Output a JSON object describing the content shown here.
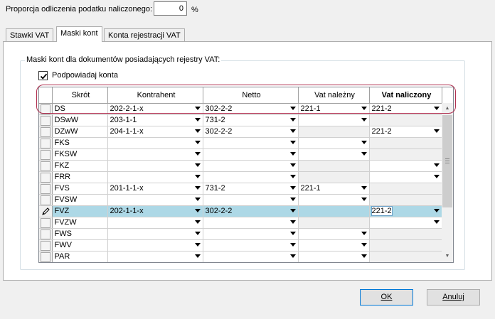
{
  "top": {
    "label": "Proporcja odliczenia podatku naliczonego:",
    "value": "0",
    "unit": "%"
  },
  "tabs": [
    {
      "label": "Stawki VAT",
      "active": false
    },
    {
      "label": "Maski kont",
      "active": true
    },
    {
      "label": "Konta rejestracji VAT",
      "active": false
    }
  ],
  "group": {
    "title": "Maski kont dla dokumentów posiadających rejestry VAT:",
    "checkbox_label": "Podpowiadaj konta",
    "checkbox_checked": true
  },
  "grid": {
    "columns": [
      "Skrót",
      "Kontrahent",
      "Netto",
      "Vat należny",
      "Vat naliczony"
    ],
    "rows": [
      {
        "skrot": "DS",
        "kontrahent": "202-2-1-x",
        "netto": "302-2-2",
        "vat_nalezny": "221-1",
        "vat_naliczony": "221-2"
      },
      {
        "skrot": "DSwW",
        "kontrahent": "203-1-1",
        "netto": "731-2",
        "vat_nalezny": "",
        "vat_naliczony": ""
      },
      {
        "skrot": "DZwW",
        "kontrahent": "204-1-1-x",
        "netto": "302-2-2",
        "vat_nalezny": "",
        "vat_naliczony": "221-2"
      },
      {
        "skrot": "FKS",
        "kontrahent": "",
        "netto": "",
        "vat_nalezny": "",
        "vat_naliczony": ""
      },
      {
        "skrot": "FKSW",
        "kontrahent": "",
        "netto": "",
        "vat_nalezny": "",
        "vat_naliczony": ""
      },
      {
        "skrot": "FKZ",
        "kontrahent": "",
        "netto": "",
        "vat_nalezny": "",
        "vat_naliczony": ""
      },
      {
        "skrot": "FRR",
        "kontrahent": "",
        "netto": "",
        "vat_nalezny": "",
        "vat_naliczony": ""
      },
      {
        "skrot": "FVS",
        "kontrahent": "201-1-1-x",
        "netto": "731-2",
        "vat_nalezny": "221-1",
        "vat_naliczony": ""
      },
      {
        "skrot": "FVSW",
        "kontrahent": "",
        "netto": "",
        "vat_nalezny": "",
        "vat_naliczony": ""
      },
      {
        "skrot": "FVZ",
        "kontrahent": "202-1-1-x",
        "netto": "302-2-2",
        "vat_nalezny": "",
        "vat_naliczony": "221-2"
      },
      {
        "skrot": "FVZW",
        "kontrahent": "",
        "netto": "",
        "vat_nalezny": "",
        "vat_naliczony": ""
      },
      {
        "skrot": "FWS",
        "kontrahent": "",
        "netto": "",
        "vat_nalezny": "",
        "vat_naliczony": ""
      },
      {
        "skrot": "FWV",
        "kontrahent": "",
        "netto": "",
        "vat_nalezny": "",
        "vat_naliczony": ""
      },
      {
        "skrot": "PAR",
        "kontrahent": "",
        "netto": "",
        "vat_nalezny": "",
        "vat_naliczony": ""
      }
    ]
  },
  "buttons": {
    "ok_label": "OK",
    "cancel_label": "Anuluj"
  },
  "colors": {
    "selected_row": "#add8e6",
    "highlight_frame": "#b03050",
    "default_button_border": "#0078d7"
  }
}
